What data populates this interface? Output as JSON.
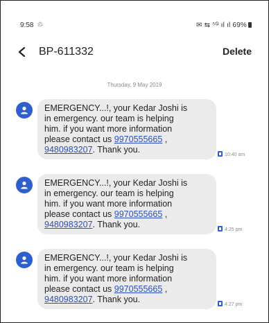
{
  "status_bar": {
    "time": "9:58",
    "sync_glyph": "♲",
    "indicators": "✉ ⇆ ⁵ᴳ ıl ıl 69%"
  },
  "header": {
    "title": "BP-611332",
    "delete_label": "Delete"
  },
  "date_separator": "Thursday, 9 May 2019",
  "messages": [
    {
      "line1": "EMERGENCY...!, your Kedar Joshi is",
      "line2": "in emergency. our team is helping",
      "line3": "him. if you want more information",
      "line4_prefix": "please contact us ",
      "phone1": "9970555665",
      "line4_suffix": " ,",
      "phone2": "9480983207",
      "line5_suffix": ". Thank you.",
      "time": "10:40 am"
    },
    {
      "line1": "EMERGENCY...!, your Kedar Joshi is",
      "line2": "in emergency. our team is helping",
      "line3": "him. if you want more information",
      "line4_prefix": "please contact us ",
      "phone1": "9970555665",
      "line4_suffix": " ,",
      "phone2": "9480983207",
      "line5_suffix": ". Thank you.",
      "time": "4:25 pm"
    },
    {
      "line1": "EMERGENCY...!, your Kedar Joshi is",
      "line2": "in emergency. our team is helping",
      "line3": "him. if you want more information",
      "line4_prefix": "please contact us ",
      "phone1": "9970555665",
      "line4_suffix": " ,",
      "phone2": "9480983207",
      "line5_suffix": ". Thank you.",
      "time": "4:27 pm"
    }
  ],
  "icons": {
    "back": "chevron-left-icon",
    "avatar": "person-icon",
    "sim": "sim-card-icon"
  },
  "colors": {
    "accent": "#2d5fcf",
    "link": "#2b4fc0",
    "bubble": "#ebebeb"
  }
}
